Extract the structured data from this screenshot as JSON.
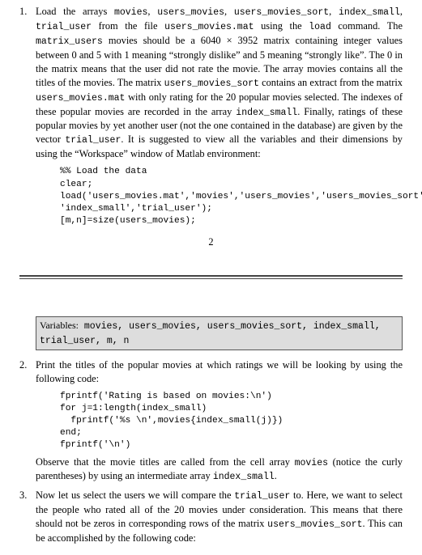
{
  "items": {
    "i1": {
      "num": "1.",
      "para1_parts": [
        "Load the arrays ",
        "movies",
        ", ",
        "users_movies",
        ", ",
        "users_movies_sort",
        ", ",
        "index_small",
        ", ",
        "trial_user",
        " from the file ",
        "users_movies.mat",
        " using the ",
        "load",
        " command. The ",
        "matrix_users",
        " movies should be a 6040 × 3952 matrix containing integer values between 0 and 5 with 1 meaning “strongly dislike” and 5 meaning “strongly like”. The 0 in the matrix means that the user did not rate the movie. The array movies contains all the titles of the movies. The matrix ",
        "users_movies_sort",
        " contains an extract from the matrix ",
        "users_movies.mat",
        " with only rating for the 20 popular movies selected. The indexes of these popular movies are recorded in the array ",
        "index_small",
        ". Finally, ratings of these popular movies by yet another user (not the one contained in the database) are given by the vector ",
        "trial_user",
        ". It is suggested to view all the variables and their dimensions by using the “Workspace” window of Matlab environment:"
      ],
      "code": "%% Load the data\nclear;\nload('users_movies.mat','movies','users_movies','users_movies_sort',...\n'index_small','trial_user');\n[m,n]=size(users_movies);"
    },
    "pagenum": "2",
    "varbox": {
      "label": "Variables:",
      "vars": " movies, users_movies, users_movies_sort, index_small, trial_user, m, n"
    },
    "i2": {
      "num": "2.",
      "para1": "Print the titles of the popular movies at which ratings we will be looking by using the following code:",
      "code": "fprintf('Rating is based on movies:\\n')\nfor j=1:length(index_small)\n  fprintf('%s \\n',movies{index_small(j)})\nend;\nfprintf('\\n')",
      "para2_parts": [
        "Observe that the movie titles are called from the cell array ",
        "movies",
        " (notice the curly parentheses) by using an intermediate array ",
        "index_small",
        "."
      ]
    },
    "i3": {
      "num": "3.",
      "para1_parts": [
        "Now let us select the users we will compare the ",
        "trial_user",
        " to. Here, we want to select the people who rated all of the 20 movies under consideration. This means that there should not be zeros in corresponding rows of the matrix ",
        "users_movies_sort",
        ". This can be accomplished by the following code:"
      ]
    }
  }
}
